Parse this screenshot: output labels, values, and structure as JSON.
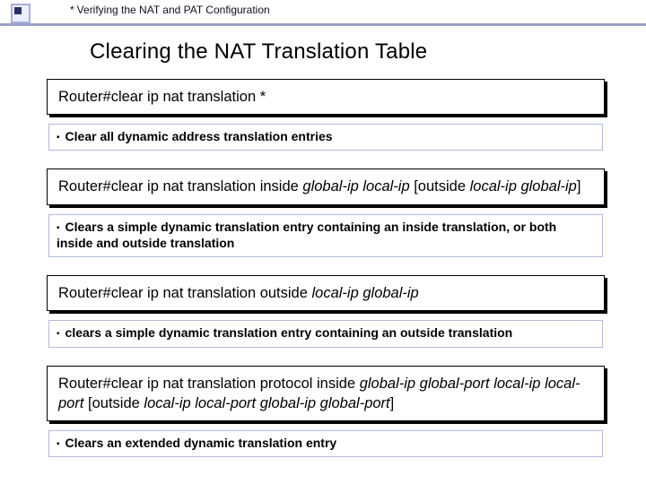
{
  "header": {
    "breadcrumb": "Verifying the NAT and PAT Configuration"
  },
  "title": "Clearing the NAT Translation Table",
  "blocks": [
    {
      "cmd_plain": "Router#clear ip nat translation *",
      "desc": "Clear all dynamic address translation entries"
    },
    {
      "cmd_prefix": "Router#clear ip nat translation inside ",
      "cmd_ital1": "global-ip local-ip",
      "cmd_mid": "  [outside ",
      "cmd_ital2": "local-ip global-ip",
      "cmd_suffix": "]",
      "desc": "Clears a simple dynamic translation entry containing an inside translation, or both inside and outside translation"
    },
    {
      "cmd_prefix": "Router#clear ip nat translation outside ",
      "cmd_ital1": "local-ip global-ip",
      "desc": "clears a simple dynamic translation entry containing an outside translation"
    },
    {
      "cmd_prefix": "Router#clear ip nat translation protocol inside ",
      "cmd_ital1": "global-ip global-port  local-ip  local-port",
      "cmd_mid": " [outside ",
      "cmd_ital2": "local-ip local-port global-ip global-port",
      "cmd_suffix": "]",
      "desc": "Clears an extended dynamic translation entry"
    }
  ]
}
